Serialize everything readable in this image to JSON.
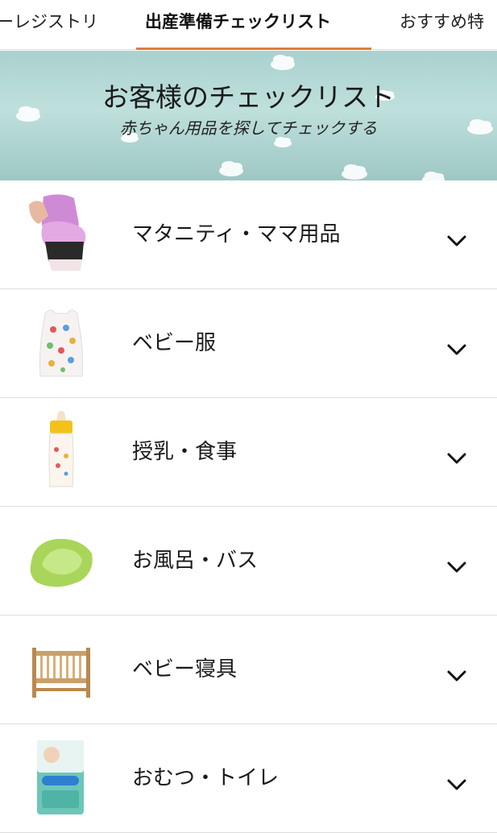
{
  "tabs": {
    "items": [
      {
        "label": "ーレジストリ",
        "active": false
      },
      {
        "label": "出産準備チェックリスト",
        "active": true
      },
      {
        "label": "おすすめ特",
        "active": false
      }
    ],
    "accent_color": "#e07b39"
  },
  "banner": {
    "title": "お客様のチェックリスト",
    "subtitle": "赤ちゃん用品を探してチェックする"
  },
  "categories": [
    {
      "label": "マタニティ・ママ用品",
      "icon": "maternity-belt-icon"
    },
    {
      "label": "ベビー服",
      "icon": "baby-sleepwear-icon"
    },
    {
      "label": "授乳・食事",
      "icon": "baby-bottle-icon"
    },
    {
      "label": "お風呂・バス",
      "icon": "baby-bathtub-icon"
    },
    {
      "label": "ベビー寝具",
      "icon": "baby-crib-icon"
    },
    {
      "label": "おむつ・トイレ",
      "icon": "diaper-pack-icon"
    }
  ],
  "chevron_icon": "chevron-down-icon"
}
